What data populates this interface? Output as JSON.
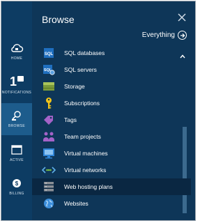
{
  "rail": {
    "items": [
      {
        "label": "HOME",
        "icon": "cloud-icon"
      },
      {
        "label": "NOTIFICATIONS",
        "count": "1",
        "icon": "notification-icon"
      },
      {
        "label": "BROWSE",
        "icon": "browse-icon"
      },
      {
        "label": "ACTIVE",
        "icon": "active-icon"
      },
      {
        "label": "BILLING",
        "icon": "billing-icon"
      }
    ]
  },
  "panel": {
    "title": "Browse",
    "everything_label": "Everything"
  },
  "list": {
    "items": [
      {
        "label": "SQL databases",
        "icon": "sql-database-icon"
      },
      {
        "label": "SQL servers",
        "icon": "sql-server-icon"
      },
      {
        "label": "Storage",
        "icon": "storage-icon"
      },
      {
        "label": "Subscriptions",
        "icon": "key-icon"
      },
      {
        "label": "Tags",
        "icon": "tag-icon"
      },
      {
        "label": "Team projects",
        "icon": "team-projects-icon"
      },
      {
        "label": "Virtual machines",
        "icon": "virtual-machine-icon"
      },
      {
        "label": "Virtual networks",
        "icon": "virtual-network-icon"
      },
      {
        "label": "Web hosting plans",
        "icon": "web-hosting-plan-icon",
        "selected": true
      },
      {
        "label": "Websites",
        "icon": "globe-icon"
      }
    ]
  },
  "colors": {
    "rail_bg": "#0d3c63",
    "panel_bg": "#0e3658",
    "selected_bg": "#0a2742",
    "active_rail_bg": "#1d5c8c"
  }
}
